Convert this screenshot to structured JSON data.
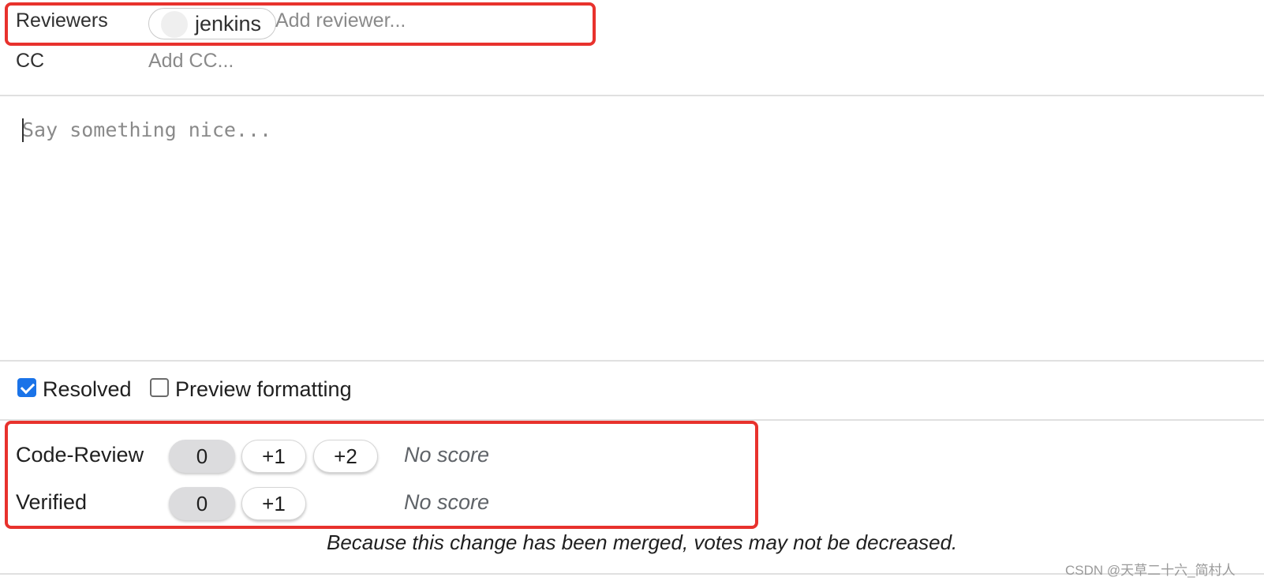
{
  "reviewers": {
    "label": "Reviewers",
    "chip_name": "jenkins",
    "placeholder": "Add reviewer..."
  },
  "cc": {
    "label": "CC",
    "placeholder": "Add CC..."
  },
  "comment": {
    "placeholder": "Say something nice..."
  },
  "options": {
    "resolved_label": "Resolved",
    "resolved_checked": true,
    "preview_label": "Preview formatting",
    "preview_checked": false
  },
  "votes": {
    "code_review": {
      "label": "Code-Review",
      "buttons": [
        "0",
        "+1",
        "+2"
      ],
      "selected": "0",
      "score_text": "No score"
    },
    "verified": {
      "label": "Verified",
      "buttons": [
        "0",
        "+1"
      ],
      "selected": "0",
      "score_text": "No score"
    }
  },
  "footnote": "Because this change has been merged, votes may not be decreased.",
  "watermark": "CSDN @天草二十六_简村人",
  "colors": {
    "highlight_box": "#e8322d",
    "checkbox_checked": "#1a73e8",
    "selected_vote_bg": "#dcdcde",
    "divider": "#e0e0e0"
  }
}
